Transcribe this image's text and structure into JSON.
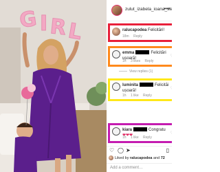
{
  "post": {
    "username": "zulut_izabela_ioana_ste",
    "more_icon": "more-dots-icon",
    "balloon_text": "GIRL"
  },
  "comments": [
    {
      "name": "ralucapodea",
      "text": "Felicitări!",
      "text_line2": "",
      "time": "18m",
      "reply": "Reply",
      "likes": ""
    },
    {
      "name": "emma",
      "text": "Felicitări",
      "text_line2": "ușoară!",
      "time": "1h",
      "likes": "3 likes",
      "reply": "Reply"
    },
    {
      "name": "luminita",
      "text": "Felicităi",
      "text_line2": "ușoară!",
      "time": "1h",
      "likes": "1 like",
      "reply": "Reply"
    },
    {
      "name": "kiara",
      "text": "Congratu",
      "text_line2": "❤❤❤",
      "time": "1h",
      "likes": "1 like",
      "reply": "Reply"
    }
  ],
  "view_replies": "View replies (1)",
  "actions": {
    "like_icon": "heart-icon",
    "comment_icon": "comment-icon",
    "share_icon": "share-icon",
    "save_icon": "bookmark-icon"
  },
  "liked_by": {
    "prefix": "Liked by",
    "user": "ralucapodea",
    "joiner": "and",
    "count": "72"
  },
  "add_comment_placeholder": "Add a comment…",
  "colors": {
    "highlight_red": "#e8203a",
    "highlight_orange": "#ff8a1c",
    "highlight_yellow": "#ffe81a",
    "highlight_magenta": "#c41bb0",
    "robe_purple": "#5b1f8c",
    "balloon_pink": "#f3a9c4"
  }
}
